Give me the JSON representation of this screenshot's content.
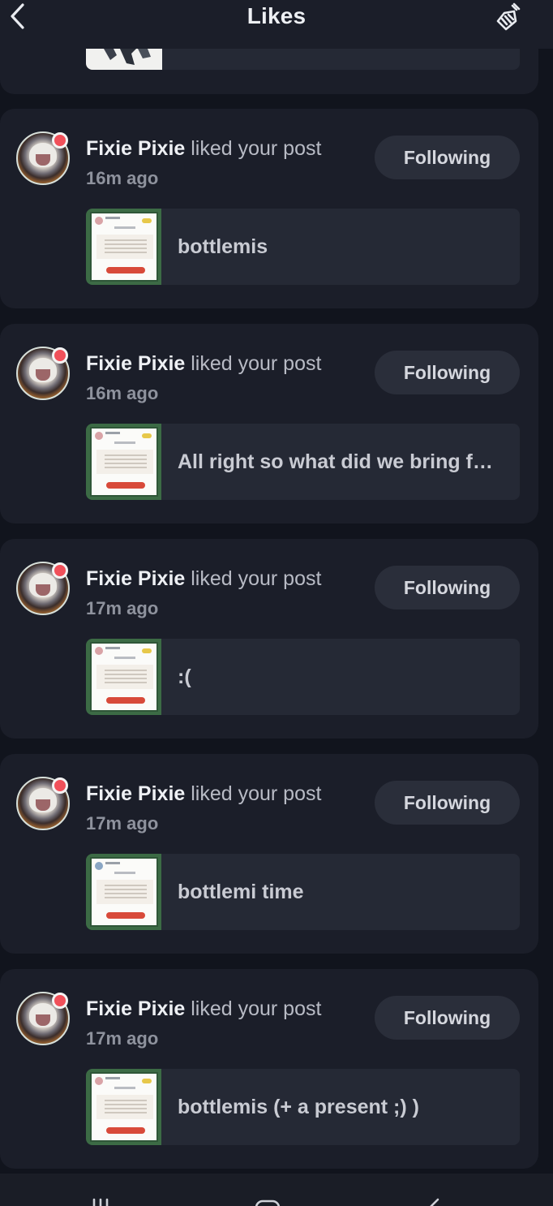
{
  "header": {
    "title": "Likes",
    "back_icon": "chevron-left-icon",
    "action_icon": "broom-clear-icon"
  },
  "notifications": [
    {
      "username": "Fixie Pixie",
      "action": " liked your post",
      "time": "16m ago",
      "button": "Following",
      "preview": "bottlemis"
    },
    {
      "username": "Fixie Pixie",
      "action": " liked your post",
      "time": "16m ago",
      "button": "Following",
      "preview": "All right so what did we bring for..."
    },
    {
      "username": "Fixie Pixie",
      "action": " liked your post",
      "time": "17m ago",
      "button": "Following",
      "preview": ":("
    },
    {
      "username": "Fixie Pixie",
      "action": " liked your post",
      "time": "17m ago",
      "button": "Following",
      "preview": "bottlemi time"
    },
    {
      "username": "Fixie Pixie",
      "action": " liked your post",
      "time": "17m ago",
      "button": "Following",
      "preview": "bottlemis (+ a present ;) )"
    }
  ],
  "bottom_nav": {
    "items": [
      "recent-apps-icon",
      "home-icon",
      "back-icon"
    ]
  },
  "colors": {
    "background": "#11141d",
    "card": "#1b1e29",
    "preview": "#252935",
    "button": "#2a2e3a",
    "online_dot": "#f0505a"
  }
}
